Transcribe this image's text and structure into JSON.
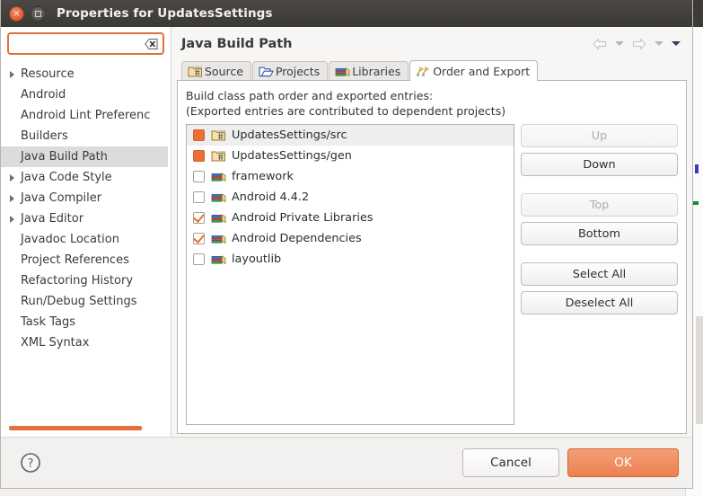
{
  "window": {
    "title": "Properties for UpdatesSettings",
    "close_label": "Close",
    "maximize_label": "Maximize"
  },
  "search": {
    "value": "",
    "placeholder": "",
    "clear_icon": "clear-text-icon"
  },
  "sidebar": {
    "items": [
      {
        "label": "Resource",
        "expandable": true,
        "selected": false
      },
      {
        "label": "Android",
        "expandable": false,
        "selected": false
      },
      {
        "label": "Android Lint Preferenc",
        "expandable": false,
        "selected": false
      },
      {
        "label": "Builders",
        "expandable": false,
        "selected": false
      },
      {
        "label": "Java Build Path",
        "expandable": false,
        "selected": true
      },
      {
        "label": "Java Code Style",
        "expandable": true,
        "selected": false
      },
      {
        "label": "Java Compiler",
        "expandable": true,
        "selected": false
      },
      {
        "label": "Java Editor",
        "expandable": true,
        "selected": false
      },
      {
        "label": "Javadoc Location",
        "expandable": false,
        "selected": false
      },
      {
        "label": "Project References",
        "expandable": false,
        "selected": false
      },
      {
        "label": "Refactoring History",
        "expandable": false,
        "selected": false
      },
      {
        "label": "Run/Debug Settings",
        "expandable": false,
        "selected": false
      },
      {
        "label": "Task Tags",
        "expandable": false,
        "selected": false
      },
      {
        "label": "XML Syntax",
        "expandable": false,
        "selected": false
      }
    ]
  },
  "page": {
    "title": "Java Build Path",
    "nav": {
      "back_icon": "back-arrow-icon",
      "back_menu_icon": "chevron-down-icon",
      "forward_icon": "forward-arrow-icon",
      "forward_menu_icon": "chevron-down-icon",
      "view_menu_icon": "chevron-down-icon"
    }
  },
  "tabs": [
    {
      "label": "Source",
      "icon": "source-folder-icon",
      "active": false
    },
    {
      "label": "Projects",
      "icon": "projects-folder-icon",
      "active": false
    },
    {
      "label": "Libraries",
      "icon": "libraries-books-icon",
      "active": false
    },
    {
      "label": "Order and Export",
      "icon": "order-export-icon",
      "active": true
    }
  ],
  "panel": {
    "description_line1": "Build class path order and exported entries:",
    "description_line2": "(Exported entries are contributed to dependent projects)",
    "entries": [
      {
        "label": "UpdatesSettings/src",
        "icon": "source-folder-icon",
        "check_state": "filled",
        "selected": true
      },
      {
        "label": "UpdatesSettings/gen",
        "icon": "source-folder-icon",
        "check_state": "filled",
        "selected": false
      },
      {
        "label": "framework",
        "icon": "libraries-books-icon",
        "check_state": "unchecked",
        "selected": false
      },
      {
        "label": "Android 4.4.2",
        "icon": "libraries-books-icon",
        "check_state": "unchecked",
        "selected": false
      },
      {
        "label": "Android Private Libraries",
        "icon": "libraries-books-icon",
        "check_state": "checked",
        "selected": false
      },
      {
        "label": "Android Dependencies",
        "icon": "libraries-books-icon",
        "check_state": "checked",
        "selected": false
      },
      {
        "label": "layoutlib",
        "icon": "libraries-books-icon",
        "check_state": "unchecked",
        "selected": false
      }
    ],
    "buttons": [
      {
        "label": "Up",
        "enabled": false,
        "gap": false
      },
      {
        "label": "Down",
        "enabled": true,
        "gap": false
      },
      {
        "label": "Top",
        "enabled": false,
        "gap": true
      },
      {
        "label": "Bottom",
        "enabled": true,
        "gap": false
      },
      {
        "label": "Select All",
        "enabled": true,
        "gap": true
      },
      {
        "label": "Deselect All",
        "enabled": true,
        "gap": false
      }
    ]
  },
  "footer": {
    "help_icon": "help-question-icon",
    "cancel_label": "Cancel",
    "ok_label": "OK"
  },
  "colors": {
    "accent_orange": "#ea6e35",
    "ok_button": "#ec8050",
    "titlebar": "#3b3936",
    "selection_grey": "#dcdcdc"
  }
}
